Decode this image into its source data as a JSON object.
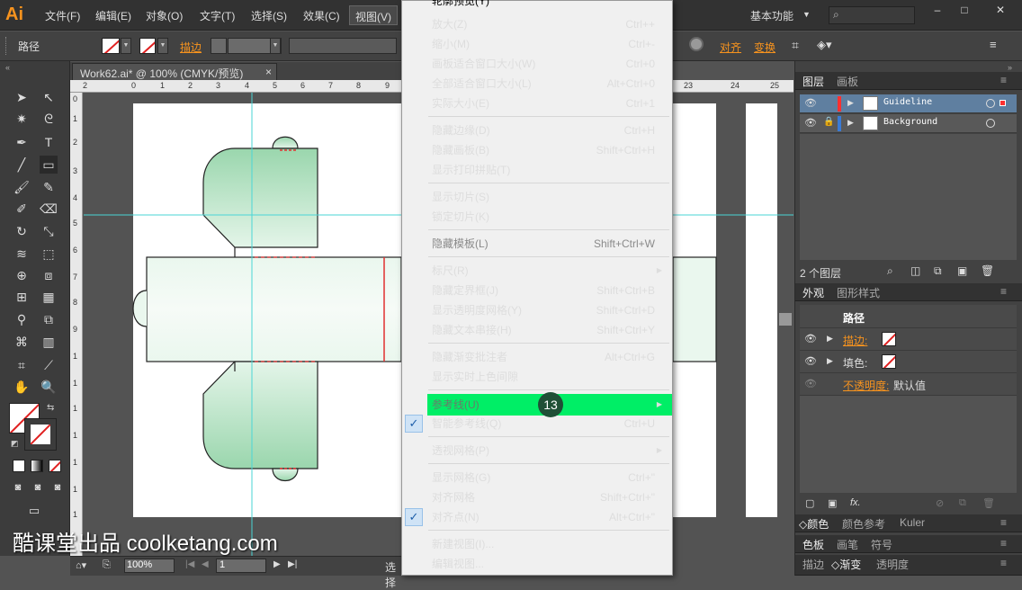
{
  "app": {
    "logo": "Ai"
  },
  "menubar": {
    "items": [
      "文件(F)",
      "编辑(E)",
      "对象(O)",
      "文字(T)",
      "选择(S)",
      "效果(C)",
      "视图(V)"
    ],
    "workspace": "基本功能",
    "search_icon": "search-icon"
  },
  "control_bar": {
    "selection_label": "路径",
    "stroke_label": "描边",
    "align_label": "对齐",
    "transform_label": "变换"
  },
  "document": {
    "tab_title": "Work62.ai* @ 100% (CMYK/预览)",
    "close": "×"
  },
  "ruler": {
    "h_ticks": [
      "2",
      "0",
      "1",
      "2",
      "3",
      "4",
      "5",
      "6",
      "7",
      "8",
      "9",
      "10"
    ],
    "h2_ticks": [
      "23",
      "24",
      "25"
    ],
    "v_ticks": [
      "0",
      "1",
      "2",
      "3",
      "4",
      "5",
      "6",
      "7",
      "8",
      "9",
      "1",
      "1",
      "1",
      "1",
      "1",
      "1",
      "1"
    ]
  },
  "status_bar": {
    "zoom": "100%",
    "page": "1",
    "status_text": "选择"
  },
  "view_menu": {
    "top_partial": "轮廓预览(Y)",
    "groups": [
      [
        {
          "label": "放大(Z)",
          "shortcut": "Ctrl++"
        },
        {
          "label": "缩小(M)",
          "shortcut": "Ctrl+-"
        },
        {
          "label": "画板适合窗口大小(W)",
          "shortcut": "Ctrl+0"
        },
        {
          "label": "全部适合窗口大小(L)",
          "shortcut": "Alt+Ctrl+0"
        },
        {
          "label": "实际大小(E)",
          "shortcut": "Ctrl+1"
        }
      ],
      [
        {
          "label": "隐藏边缘(D)",
          "shortcut": "Ctrl+H"
        },
        {
          "label": "隐藏画板(B)",
          "shortcut": "Shift+Ctrl+H"
        },
        {
          "label": "显示打印拼贴(T)",
          "shortcut": ""
        }
      ],
      [
        {
          "label": "显示切片(S)",
          "shortcut": ""
        },
        {
          "label": "锁定切片(K)",
          "shortcut": ""
        }
      ],
      [
        {
          "label": "隐藏模板(L)",
          "shortcut": "Shift+Ctrl+W",
          "disabled": true
        }
      ],
      [
        {
          "label": "标尺(R)",
          "shortcut": "",
          "submenu": true
        },
        {
          "label": "隐藏定界框(J)",
          "shortcut": "Shift+Ctrl+B"
        },
        {
          "label": "显示透明度网格(Y)",
          "shortcut": "Shift+Ctrl+D"
        },
        {
          "label": "隐藏文本串接(H)",
          "shortcut": "Shift+Ctrl+Y"
        }
      ],
      [
        {
          "label": "隐藏渐变批注者",
          "shortcut": "Alt+Ctrl+G"
        },
        {
          "label": "显示实时上色间隙",
          "shortcut": ""
        }
      ],
      [
        {
          "label": "参考线(U)",
          "shortcut": "",
          "submenu": true,
          "highlighted": true
        },
        {
          "label": "智能参考线(Q)",
          "shortcut": "Ctrl+U",
          "checked": true
        }
      ],
      [
        {
          "label": "透视网格(P)",
          "shortcut": "",
          "submenu": true
        }
      ],
      [
        {
          "label": "显示网格(G)",
          "shortcut": "Ctrl+\""
        },
        {
          "label": "对齐网格",
          "shortcut": "Shift+Ctrl+\""
        },
        {
          "label": "对齐点(N)",
          "shortcut": "Alt+Ctrl+\"",
          "checked": true
        }
      ],
      [
        {
          "label": "新建视图(I)...",
          "shortcut": ""
        },
        {
          "label": "编辑视图...",
          "shortcut": ""
        }
      ]
    ],
    "step_badge": "13"
  },
  "layers_panel": {
    "tabs": [
      "图层",
      "画板"
    ],
    "layers": [
      {
        "name": "Guideline",
        "color": "#ff3030",
        "selected": true
      },
      {
        "name": "Background",
        "color": "#3a7bd5",
        "selected": false
      }
    ],
    "count_text": "2 个图层"
  },
  "appearance_panel": {
    "tabs": [
      "外观",
      "图形样式"
    ],
    "title": "路径",
    "rows": [
      {
        "label": "描边:",
        "orange": true
      },
      {
        "label": "填色:",
        "orange": false
      }
    ],
    "opacity_label": "不透明度:",
    "opacity_value": "默认值"
  },
  "color_panel": {
    "tabs": [
      "颜色",
      "颜色参考",
      "Kuler"
    ]
  },
  "swatches_panel": {
    "tabs": [
      "色板",
      "画笔",
      "符号"
    ]
  },
  "stroke_panel": {
    "tabs": [
      "描边",
      "渐变",
      "透明度"
    ]
  },
  "watermark": "酷课堂出品 coolketang.com"
}
